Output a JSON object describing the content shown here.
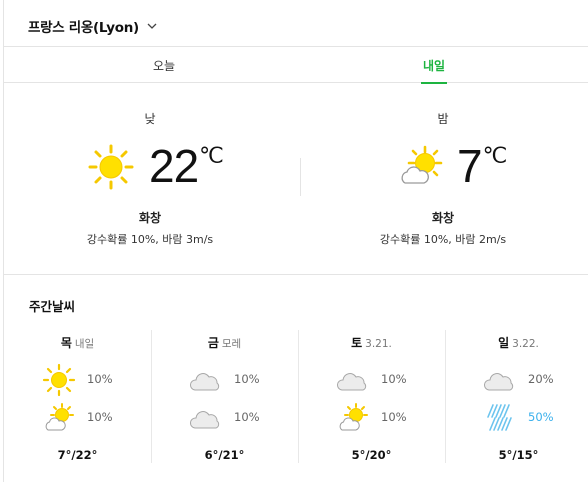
{
  "location": {
    "name": "프랑스 리옹(Lyon)",
    "icon": "chevron-down-icon"
  },
  "tabs": [
    {
      "label": "오늘",
      "active": false
    },
    {
      "label": "내일",
      "active": true
    }
  ],
  "accent_color": "#1db440",
  "forecast": {
    "day": {
      "period": "낮",
      "temp": "22",
      "unit": "℃",
      "condition": "화창",
      "details": "강수확률 10%, 바람 3m/s",
      "icon": "sun-icon"
    },
    "night": {
      "period": "밤",
      "temp": "7",
      "unit": "℃",
      "condition": "화창",
      "details": "강수확률 10%, 바람 2m/s",
      "icon": "sun-cloud-icon"
    }
  },
  "weekly": {
    "title": "주간날씨",
    "days": [
      {
        "day": "목",
        "sub": "내일",
        "am_icon": "sun-icon",
        "am_pct": "10%",
        "pm_icon": "sun-cloud-icon",
        "pm_pct": "10%",
        "temps": "7°/22°"
      },
      {
        "day": "금",
        "sub": "모레",
        "am_icon": "cloud-icon",
        "am_pct": "10%",
        "pm_icon": "cloud-icon",
        "pm_pct": "10%",
        "temps": "6°/21°"
      },
      {
        "day": "토",
        "sub": "3.21.",
        "am_icon": "cloud-icon",
        "am_pct": "10%",
        "pm_icon": "sun-cloud-icon",
        "pm_pct": "10%",
        "temps": "5°/20°"
      },
      {
        "day": "일",
        "sub": "3.22.",
        "am_icon": "cloud-icon",
        "am_pct": "20%",
        "pm_icon": "rain-icon",
        "pm_pct": "50%",
        "temps": "5°/15°"
      }
    ]
  }
}
